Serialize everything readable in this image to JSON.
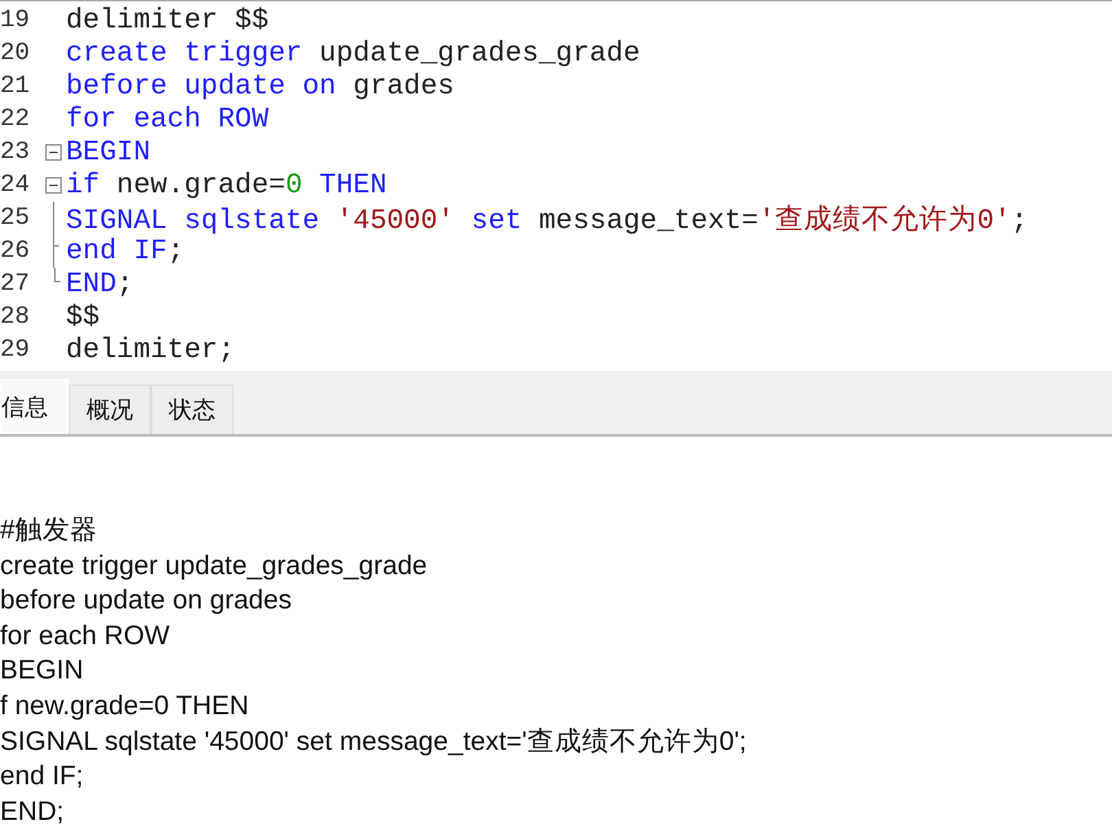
{
  "editor": {
    "lines": [
      {
        "number": "19",
        "kind": "plain",
        "tokens": [
          {
            "kind": "plain",
            "text": "delimiter $$"
          }
        ]
      },
      {
        "number": "20",
        "kind": "plain",
        "tokens": [
          {
            "kind": "keyword",
            "text": "create trigger"
          },
          {
            "kind": "plain",
            "text": " update_grades_grade"
          }
        ]
      },
      {
        "number": "21",
        "kind": "plain",
        "tokens": [
          {
            "kind": "keyword",
            "text": "before update on"
          },
          {
            "kind": "plain",
            "text": " grades"
          }
        ]
      },
      {
        "number": "22",
        "kind": "plain",
        "tokens": [
          {
            "kind": "keyword",
            "text": "for each ROW"
          }
        ]
      },
      {
        "number": "23",
        "kind": "foldstart",
        "tokens": [
          {
            "kind": "keyword",
            "text": "BEGIN"
          }
        ]
      },
      {
        "number": "24",
        "kind": "foldstart",
        "tokens": [
          {
            "kind": "keyword",
            "text": "if"
          },
          {
            "kind": "plain",
            "text": " new.grade="
          },
          {
            "kind": "number",
            "text": "0"
          },
          {
            "kind": "keyword",
            "text": " THEN"
          }
        ]
      },
      {
        "number": "25",
        "kind": "foldbody",
        "tokens": [
          {
            "kind": "keyword",
            "text": "SIGNAL sqlstate "
          },
          {
            "kind": "string",
            "text": "'45000'"
          },
          {
            "kind": "keyword",
            "text": " set"
          },
          {
            "kind": "plain",
            "text": " message_text="
          },
          {
            "kind": "string",
            "text": "'查成绩不允许为0'"
          },
          {
            "kind": "plain",
            "text": ";"
          }
        ]
      },
      {
        "number": "26",
        "kind": "foldbranch",
        "tokens": [
          {
            "kind": "keyword",
            "text": "end IF"
          },
          {
            "kind": "plain",
            "text": ";"
          }
        ]
      },
      {
        "number": "27",
        "kind": "foldend",
        "tokens": [
          {
            "kind": "keyword",
            "text": "END"
          },
          {
            "kind": "plain",
            "text": ";"
          }
        ]
      },
      {
        "number": "28",
        "kind": "plain",
        "tokens": [
          {
            "kind": "plain",
            "text": "$$"
          }
        ]
      },
      {
        "number": "29",
        "kind": "plain",
        "tokens": [
          {
            "kind": "plain",
            "text": "delimiter;"
          }
        ]
      }
    ]
  },
  "tabs": [
    {
      "label": "信息",
      "selected": true
    },
    {
      "label": "概况",
      "selected": false
    },
    {
      "label": "状态",
      "selected": false
    }
  ],
  "output": {
    "lines": [
      "#触发器",
      "create trigger update_grades_grade",
      "before update on grades",
      "for each ROW",
      "BEGIN",
      "f new.grade=0 THEN",
      "SIGNAL sqlstate '45000' set message_text='查成绩不允许为0';",
      "end IF;",
      "END;"
    ]
  }
}
